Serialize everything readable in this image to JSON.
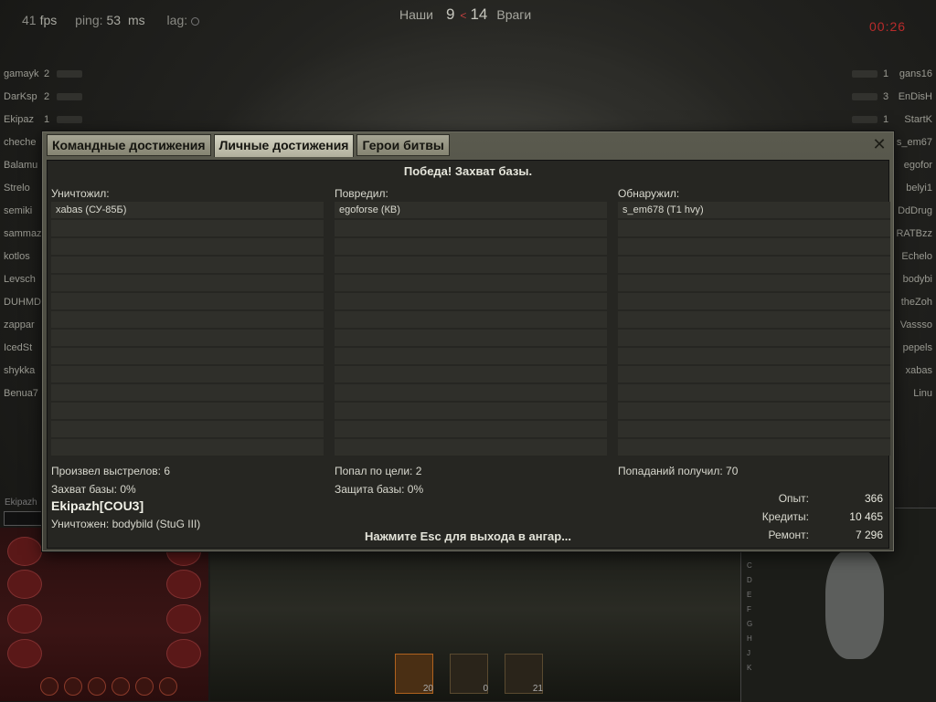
{
  "hud": {
    "fps_value": "41",
    "fps_label": "fps",
    "ping_label": "ping:",
    "ping_value": "53",
    "ping_unit": "ms",
    "lag_label": "lag:",
    "team_ours_label": "Наши",
    "team_ours_score": "9",
    "team_enemy_score": "14",
    "team_enemy_label": "Враги",
    "timer": "00:26"
  },
  "team_left": [
    {
      "name": "gamayk",
      "frags": "2"
    },
    {
      "name": "DarKsp",
      "frags": "2"
    },
    {
      "name": "Ekipaz",
      "frags": "1"
    },
    {
      "name": "cheche",
      "frags": ""
    },
    {
      "name": "Balamu",
      "frags": ""
    },
    {
      "name": "Strelo",
      "frags": ""
    },
    {
      "name": "semiki",
      "frags": ""
    },
    {
      "name": "sammaz",
      "frags": ""
    },
    {
      "name": "kotlos",
      "frags": ""
    },
    {
      "name": "Levsch",
      "frags": ""
    },
    {
      "name": "DUHMD",
      "frags": ""
    },
    {
      "name": "zappar",
      "frags": ""
    },
    {
      "name": "IcedSt",
      "frags": ""
    },
    {
      "name": "shykka",
      "frags": ""
    },
    {
      "name": "Benua7",
      "frags": ""
    }
  ],
  "team_right": [
    {
      "name": "gans16",
      "frags": "1"
    },
    {
      "name": "EnDisH",
      "frags": "3"
    },
    {
      "name": "StartK",
      "frags": "1"
    },
    {
      "name": "s_em67",
      "frags": ""
    },
    {
      "name": "egofor",
      "frags": ""
    },
    {
      "name": "belyi1",
      "frags": ""
    },
    {
      "name": "DdDrug",
      "frags": ""
    },
    {
      "name": "RATBzz",
      "frags": ""
    },
    {
      "name": "Echelo",
      "frags": ""
    },
    {
      "name": "bodybi",
      "frags": ""
    },
    {
      "name": "theZoh",
      "frags": ""
    },
    {
      "name": "Vassso",
      "frags": ""
    },
    {
      "name": "pepels",
      "frags": ""
    },
    {
      "name": "xabas",
      "frags": ""
    },
    {
      "name": "Linu",
      "frags": ""
    }
  ],
  "player_hud_name": "Ekipazh",
  "minimap": {
    "row_letters": [
      "C",
      "D",
      "E",
      "F",
      "G",
      "H",
      "J",
      "K"
    ]
  },
  "ammo": [
    {
      "count": "20",
      "active": true
    },
    {
      "count": "0",
      "active": false
    },
    {
      "count": "21",
      "active": false
    }
  ],
  "dialog": {
    "tabs": [
      {
        "label": "Командные достижения",
        "active": false
      },
      {
        "label": "Личные достижения",
        "active": true
      },
      {
        "label": "Герои битвы",
        "active": false
      }
    ],
    "close_symbol": "✕",
    "result_title": "Победа! Захват базы.",
    "columns": [
      {
        "label": "Уничтожил:",
        "items": [
          "xabas (СУ-85Б)"
        ]
      },
      {
        "label": "Повредил:",
        "items": [
          "egoforse (КВ)"
        ]
      },
      {
        "label": "Обнаружил:",
        "items": [
          "s_em678 (T1 hvy)"
        ]
      }
    ],
    "stats": {
      "shots": "Произвел выстрелов: 6",
      "base_capture": "Захват базы: 0%",
      "hits": "Попал по цели: 2",
      "base_defense": "Защита базы: 0%",
      "hits_received": "Попаданий получил: 70"
    },
    "player": {
      "name": "Ekipazh[COU3]",
      "killed_by": "Уничтожен: bodybild (StuG III)"
    },
    "rewards": [
      {
        "label": "Опыт:",
        "value": "366"
      },
      {
        "label": "Кредиты:",
        "value": "10 465"
      },
      {
        "label": "Ремонт:",
        "value": "7 296"
      }
    ],
    "footer": "Нажмите Esc для выхода в ангар..."
  }
}
